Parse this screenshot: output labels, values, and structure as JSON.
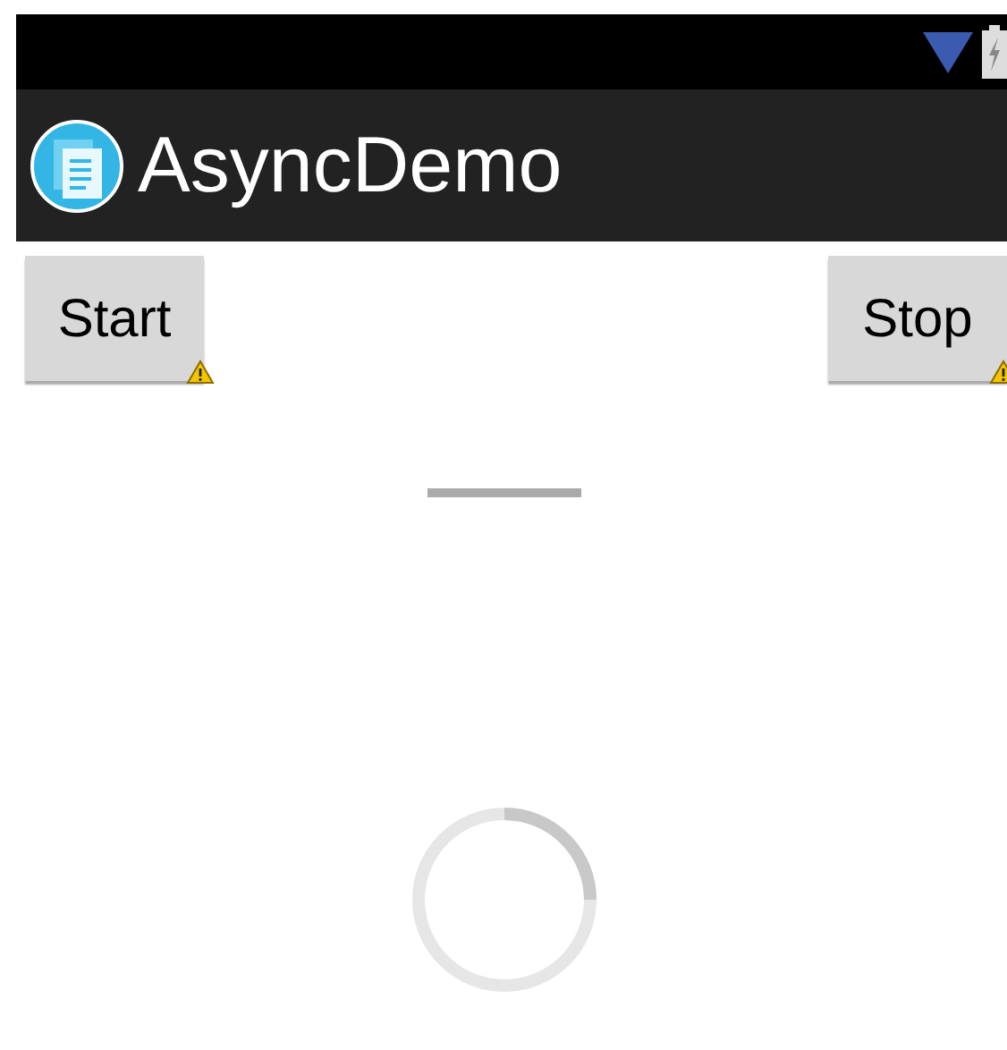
{
  "action_bar": {
    "title": "AsyncDemo"
  },
  "buttons": [
    {
      "label": "Start"
    },
    {
      "label": "Stop"
    }
  ]
}
